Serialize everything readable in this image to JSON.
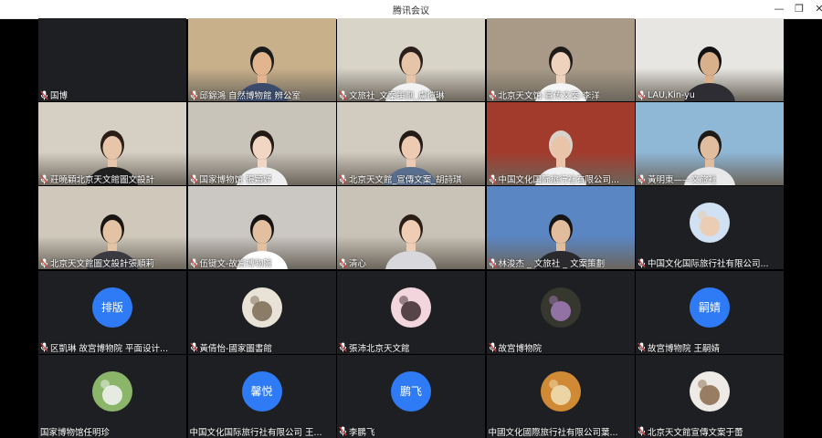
{
  "window": {
    "title": "腾讯会议",
    "controls": {
      "minimize": "—",
      "maximize": "❐",
      "close": "✕"
    }
  },
  "participants": [
    {
      "name": "国博",
      "kind": "blank"
    },
    {
      "name": "邱錦鴻 自然博物館 辨公室",
      "kind": "video",
      "bg": "#c8b08a",
      "skin": "#e2b58e",
      "hair": "#1b1b1b",
      "shirt": "#3a4b6c"
    },
    {
      "name": "文旅社_文案策劃_盧愷琳",
      "kind": "video",
      "bg": "#d9d4c8",
      "skin": "#e6c4a8",
      "hair": "#2a1f1a",
      "shirt": "#f2f2f2"
    },
    {
      "name": "北京天文馆-宣传文案-李洋",
      "kind": "video",
      "bg": "#a89a86",
      "skin": "#efd2bd",
      "hair": "#1e1b18",
      "shirt": "#f5f5f5"
    },
    {
      "name": "LAU,Kin-yu",
      "kind": "video",
      "bg": "#e8e6e2",
      "skin": "#d9b08c",
      "hair": "#121212",
      "shirt": "#2d2d33"
    },
    {
      "name": "莊曉穎北京天文館圖文設計",
      "kind": "video",
      "bg": "#d6d0c4",
      "skin": "#e7c5a9",
      "hair": "#2a1d16",
      "shirt": "#202020"
    },
    {
      "name": "国家博物馆 張穎妤",
      "kind": "video",
      "bg": "#c9c4ba",
      "skin": "#f1d6c3",
      "hair": "#231a15",
      "shirt": "#efefef"
    },
    {
      "name": "北京天文館_宣傳文案_胡詩琪",
      "kind": "video",
      "bg": "#d1cbc0",
      "skin": "#eccbb2",
      "hair": "#241b16",
      "shirt": "#5a6f8f"
    },
    {
      "name": "中国文化国际旅行社有限公司...",
      "kind": "video",
      "bg": "#a33b2c",
      "skin": "#eac4a8",
      "hair": "#d7d2cc",
      "shirt": "#f0f0f0"
    },
    {
      "name": "黃明東——文旅社",
      "kind": "video",
      "bg": "#8fb7d6",
      "skin": "#e0bd9e",
      "hair": "#1f1a16",
      "shirt": "#e8e8ea"
    },
    {
      "name": "北京天文館圖文設計張順莉",
      "kind": "video",
      "bg": "#cfc8bb",
      "skin": "#e4c3a5",
      "hair": "#191512",
      "shirt": "#3a3a40"
    },
    {
      "name": "伍键文-故宫博物院",
      "kind": "video",
      "bg": "#cbc7c2",
      "skin": "#e2bf9f",
      "hair": "#161412",
      "shirt": "#ffffff"
    },
    {
      "name": "清心",
      "kind": "video",
      "bg": "#c9c2b6",
      "skin": "#efcdb5",
      "hair": "#2b1e17",
      "shirt": "#d8d8dc"
    },
    {
      "name": "林浚杰 _ 文旅社 _ 文案策劃",
      "kind": "video",
      "bg": "#5a86c4",
      "skin": "#e2bd9d",
      "hair": "#171514",
      "shirt": "#2a2a2e"
    },
    {
      "name": "中国文化国际旅行社有限公司...",
      "kind": "image-avatar",
      "avatar": "avatar-illustration",
      "c1": "#cfe1f2",
      "c2": "#f0c9a8"
    },
    {
      "name": "区凱琳 故宫博物院 平面设计...",
      "kind": "text-avatar",
      "avatar_text": "排版"
    },
    {
      "name": "黃倩怡-國家圖書館",
      "kind": "image-avatar",
      "avatar": "avatar-handwriting",
      "c1": "#e8e3d6",
      "c2": "#7a6a55"
    },
    {
      "name": "張沛北京天文館",
      "kind": "image-avatar",
      "avatar": "avatar-anime",
      "c1": "#f3d5dd",
      "c2": "#3b2a2e"
    },
    {
      "name": "故宫博物院",
      "kind": "image-avatar",
      "avatar": "avatar-flowers",
      "c1": "#36382f",
      "c2": "#a27bb8"
    },
    {
      "name": "故宫博物院 王嗣婧",
      "kind": "text-avatar",
      "avatar_text": "嗣婧"
    },
    {
      "name": "国家博物馆任明珍",
      "kind": "image-avatar",
      "avatar": "avatar-cat-grass",
      "c1": "#8bb66a",
      "c2": "#f4f4f4",
      "no_mic": true
    },
    {
      "name": "中国文化国际旅行社有限公司 王...",
      "kind": "text-avatar",
      "avatar_text": "馨悦",
      "no_mic": true
    },
    {
      "name": "李鹏飞",
      "kind": "text-avatar",
      "avatar_text": "鹏飞"
    },
    {
      "name": "中國文化國際旅行社有限公司葉...",
      "kind": "image-avatar",
      "avatar": "avatar-food",
      "c1": "#d08a35",
      "c2": "#f2e0b8",
      "no_mic": true
    },
    {
      "name": "北京天文館宣傳文案于蕾",
      "kind": "image-avatar",
      "avatar": "avatar-plush-dog",
      "c1": "#eeeae6",
      "c2": "#8a6a4a"
    }
  ],
  "colors": {
    "tile_bg": "#1e1f22",
    "text_avatar_bg": "#2f7bf5",
    "mic_muted": "#e23b3b"
  }
}
